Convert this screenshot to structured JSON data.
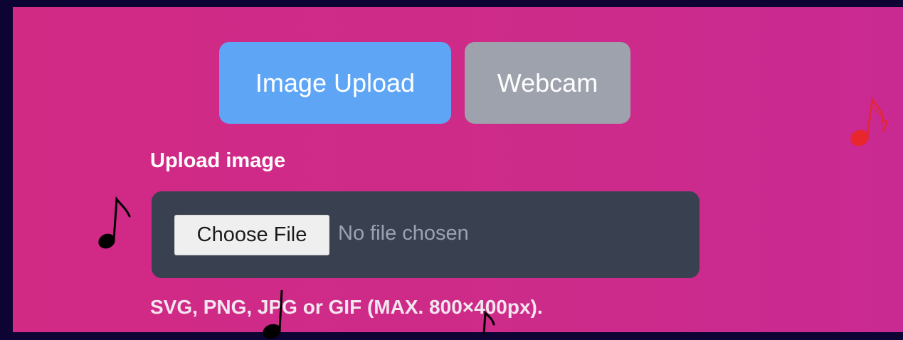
{
  "tabs": {
    "upload_label": "Image Upload",
    "webcam_label": "Webcam",
    "active": "Image Upload"
  },
  "upload": {
    "label": "Upload image",
    "button_label": "Choose File",
    "status": "No file chosen",
    "helper": "SVG, PNG, JPG or GIF (MAX. 800×400px)."
  },
  "decor": {
    "music_note_icon_color_black": "#000000",
    "music_note_icon_color_red": "#e8262e"
  },
  "colors": {
    "page_background": "#0e0434",
    "panel_background": "#cf2b89",
    "active_tab": "#5ea6f5",
    "inactive_tab": "#9da2ac",
    "file_box": "#394150"
  }
}
